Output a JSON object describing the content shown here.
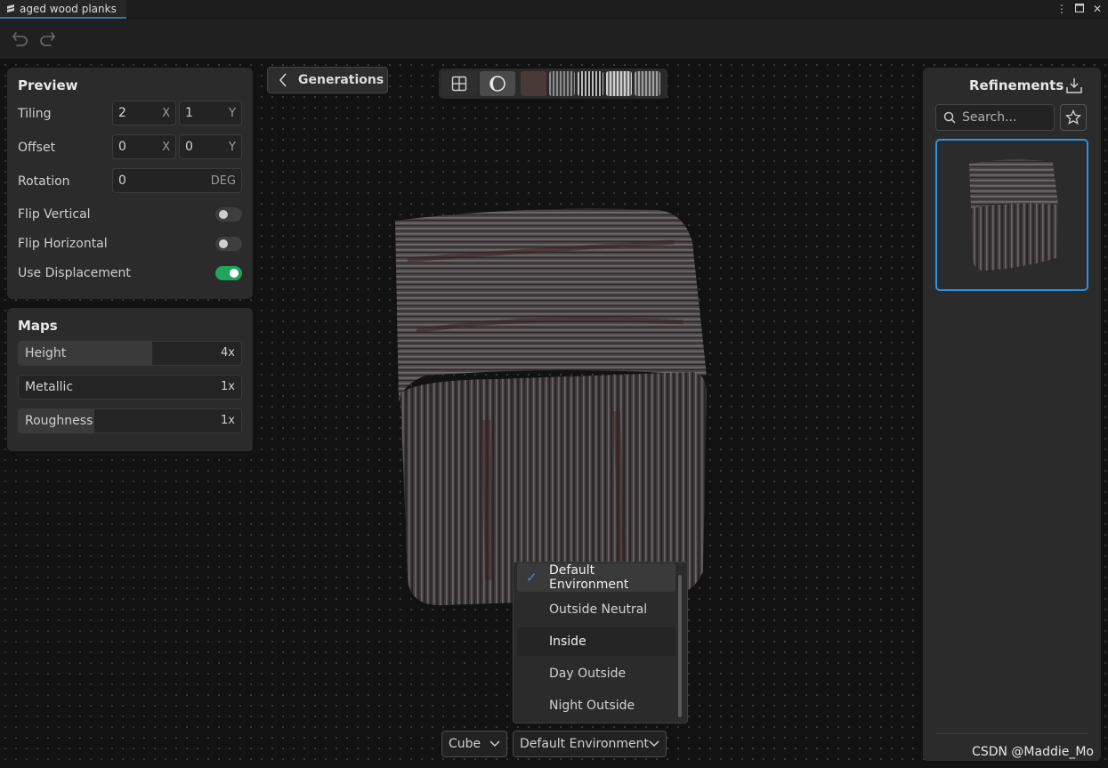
{
  "window": {
    "tab_title": "aged wood planks",
    "controls": [
      "more-icon",
      "maximize-icon",
      "close-icon"
    ]
  },
  "toolbar": {
    "undo_icon": "undo-icon",
    "redo_icon": "redo-icon"
  },
  "preview": {
    "title": "Preview",
    "tiling_label": "Tiling",
    "tiling_x": "2",
    "tiling_x_unit": "X",
    "tiling_y": "1",
    "tiling_y_unit": "Y",
    "offset_label": "Offset",
    "offset_x": "0",
    "offset_x_unit": "X",
    "offset_y": "0",
    "offset_y_unit": "Y",
    "rotation_label": "Rotation",
    "rotation_value": "0",
    "rotation_unit": "DEG",
    "flip_vertical_label": "Flip Vertical",
    "flip_vertical": false,
    "flip_horizontal_label": "Flip Horizontal",
    "flip_horizontal": false,
    "use_displacement_label": "Use Displacement",
    "use_displacement": true
  },
  "maps": {
    "title": "Maps",
    "items": [
      {
        "label": "Height",
        "value": "4x",
        "level": 0.6
      },
      {
        "label": "Metallic",
        "value": "1x",
        "level": 0.0
      },
      {
        "label": "Roughness",
        "value": "1x",
        "level": 0.34
      }
    ]
  },
  "generations_button": "Generations",
  "view_modes": [
    "grid-view-icon",
    "sphere-view-icon"
  ],
  "texture_swatches": [
    "base-color",
    "normal",
    "height",
    "roughness",
    "ambient-occlusion"
  ],
  "refinements": {
    "title": "Refinements",
    "download_icon": "download-icon",
    "search_placeholder": "Search...",
    "favorite_icon": "star-icon"
  },
  "environment_menu": {
    "items": [
      "Default Environment",
      "Outside Neutral",
      "Inside",
      "Day Outside",
      "Night Outside"
    ],
    "selected": "Default Environment",
    "hovered": "Inside"
  },
  "bottom_bar": {
    "shape": "Cube",
    "environment": "Default Environment"
  },
  "watermark": "CSDN @Maddie_Mo",
  "colors": {
    "accent_blue": "#2f8fe8",
    "toggle_on": "#1fa65a",
    "panel": "#2b2b2b",
    "background": "#121212"
  }
}
